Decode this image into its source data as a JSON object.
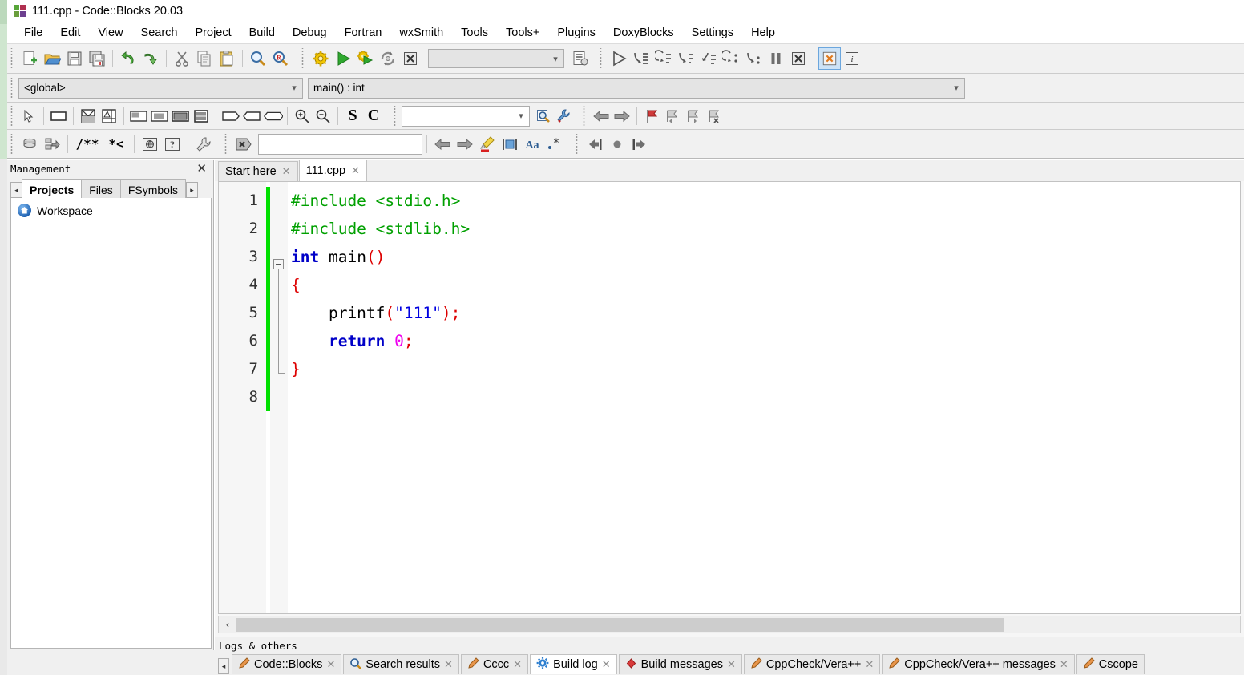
{
  "window": {
    "title": "111.cpp - Code::Blocks 20.03",
    "logo_name": "codeblocks-logo"
  },
  "menubar": {
    "items": [
      {
        "label": "File"
      },
      {
        "label": "Edit"
      },
      {
        "label": "View"
      },
      {
        "label": "Search"
      },
      {
        "label": "Project"
      },
      {
        "label": "Build"
      },
      {
        "label": "Debug"
      },
      {
        "label": "Fortran"
      },
      {
        "label": "wxSmith"
      },
      {
        "label": "Tools"
      },
      {
        "label": "Tools+"
      },
      {
        "label": "Plugins"
      },
      {
        "label": "DoxyBlocks"
      },
      {
        "label": "Settings"
      },
      {
        "label": "Help"
      }
    ]
  },
  "toolbars": {
    "main": {
      "buttons": [
        {
          "name": "new-file-icon",
          "title": "New file"
        },
        {
          "name": "open-file-icon",
          "title": "Open"
        },
        {
          "name": "save-icon",
          "title": "Save"
        },
        {
          "name": "save-all-icon",
          "title": "Save all"
        },
        {
          "name": "undo-icon",
          "title": "Undo"
        },
        {
          "name": "redo-icon",
          "title": "Redo"
        },
        {
          "name": "cut-icon",
          "title": "Cut"
        },
        {
          "name": "copy-icon",
          "title": "Copy"
        },
        {
          "name": "paste-icon",
          "title": "Paste"
        },
        {
          "name": "find-icon",
          "title": "Find"
        },
        {
          "name": "replace-icon",
          "title": "Replace"
        }
      ]
    },
    "build": {
      "buttons": [
        {
          "name": "build-icon",
          "title": "Build"
        },
        {
          "name": "run-icon",
          "title": "Run"
        },
        {
          "name": "build-and-run-icon",
          "title": "Build and run"
        },
        {
          "name": "rebuild-icon",
          "title": "Rebuild"
        },
        {
          "name": "abort-build-icon",
          "title": "Abort"
        }
      ],
      "target_value": "",
      "target_placeholder": "",
      "extra_button": {
        "name": "build-target-options-icon",
        "title": "Build targets"
      }
    },
    "debug": {
      "buttons": [
        {
          "name": "debug-continue-icon",
          "title": "Debug / Continue"
        },
        {
          "name": "run-to-cursor-icon",
          "title": "Run to cursor"
        },
        {
          "name": "next-line-icon",
          "title": "Next line"
        },
        {
          "name": "step-into-icon",
          "title": "Step into"
        },
        {
          "name": "step-out-icon",
          "title": "Step out"
        },
        {
          "name": "next-instruction-icon",
          "title": "Next instruction"
        },
        {
          "name": "step-into-instruction-icon",
          "title": "Step into instruction"
        },
        {
          "name": "break-debugger-icon",
          "title": "Break debugger"
        },
        {
          "name": "stop-debugger-icon",
          "title": "Stop debugger"
        },
        {
          "name": "debugging-windows-icon",
          "title": "Debugging windows"
        },
        {
          "name": "various-info-icon",
          "title": "Various info"
        }
      ]
    },
    "scope": {
      "global_value": "<global>",
      "function_value": "main() : int"
    },
    "wxsmith": {
      "buttons": [
        {
          "name": "pointer-icon",
          "title": "Select"
        },
        {
          "name": "panel-icon",
          "title": "Panel"
        },
        {
          "name": "split-vertical-icon",
          "title": "Split vertical"
        },
        {
          "name": "split-custom-icon",
          "title": "Custom split"
        },
        {
          "name": "layout-left-icon",
          "title": "Layout left"
        },
        {
          "name": "layout-center-icon",
          "title": "Layout center"
        },
        {
          "name": "layout-fill-icon",
          "title": "Layout fill"
        },
        {
          "name": "layout-stack-icon",
          "title": "Layout stack"
        },
        {
          "name": "expand-right-icon",
          "title": "Expand right"
        },
        {
          "name": "expand-left-icon",
          "title": "Expand left"
        },
        {
          "name": "expand-both-icon",
          "title": "Expand both"
        }
      ]
    },
    "zoom": {
      "buttons": [
        {
          "name": "zoom-in-icon",
          "title": "Zoom in"
        },
        {
          "name": "zoom-out-icon",
          "title": "Zoom out"
        }
      ],
      "labels": [
        "S",
        "C"
      ]
    },
    "incremental_search": {
      "value": "",
      "placeholder": "",
      "buttons": [
        {
          "name": "search-preview-icon",
          "title": "Search"
        },
        {
          "name": "search-options-icon",
          "title": "Options"
        }
      ]
    },
    "navigation": {
      "buttons": [
        {
          "name": "back-icon",
          "title": "Back"
        },
        {
          "name": "forward-icon",
          "title": "Forward"
        },
        {
          "name": "toggle-bookmark-icon",
          "title": "Toggle bookmark"
        },
        {
          "name": "previous-bookmark-icon",
          "title": "Previous bookmark"
        },
        {
          "name": "next-bookmark-icon",
          "title": "Next bookmark"
        },
        {
          "name": "clear-bookmarks-icon",
          "title": "Clear bookmarks"
        }
      ]
    },
    "doxyblocks": {
      "buttons": [
        {
          "name": "doxyblocks-run-icon",
          "title": "Run DoxyBlocks"
        },
        {
          "name": "doxyblocks-extract-icon",
          "title": "Extract documentation"
        }
      ],
      "labels": [
        "/**",
        "*<"
      ],
      "more_buttons": [
        {
          "name": "doxyblocks-html-icon",
          "title": "Open HTML docs"
        },
        {
          "name": "doxyblocks-chm-icon",
          "title": "Open CHM docs"
        },
        {
          "name": "doxyblocks-config-icon",
          "title": "Configure"
        }
      ]
    },
    "thread_search": {
      "run_button": {
        "name": "thread-search-icon",
        "title": "Thread search"
      },
      "value": "",
      "placeholder": "",
      "buttons": [
        {
          "name": "search-back-icon",
          "title": "Search backwards"
        },
        {
          "name": "search-forward-icon",
          "title": "Search forwards"
        },
        {
          "name": "highlight-icon",
          "title": "Highlight"
        },
        {
          "name": "whole-word-icon",
          "title": "Whole word"
        },
        {
          "name": "match-case-icon",
          "title": "Match case"
        },
        {
          "name": "regex-icon",
          "title": "Regular expression"
        }
      ]
    },
    "browse_tracker": {
      "buttons": [
        {
          "name": "browse-backward-icon",
          "title": "Backward ed position"
        },
        {
          "name": "browse-mark-icon",
          "title": "Mark position"
        },
        {
          "name": "browse-forward-icon",
          "title": "Forward ed position"
        }
      ]
    }
  },
  "management": {
    "title": "Management",
    "close_label": "✕",
    "scroll_left": "◂",
    "scroll_right": "▸",
    "tabs": [
      {
        "label": "Projects",
        "selected": true
      },
      {
        "label": "Files",
        "selected": false
      },
      {
        "label": "FSymbols",
        "selected": false
      }
    ],
    "tree": [
      {
        "label": "Workspace",
        "icon": "home-icon"
      }
    ]
  },
  "editor": {
    "tabs": [
      {
        "label": "Start here",
        "selected": false,
        "close": "✕"
      },
      {
        "label": "111.cpp",
        "selected": true,
        "close": "✕"
      }
    ],
    "line_numbers": [
      "1",
      "2",
      "3",
      "4",
      "5",
      "6",
      "7",
      "8"
    ],
    "code_lines": [
      {
        "n": 1,
        "tokens": [
          {
            "t": "#include <stdio.h>",
            "c": "t-pre"
          }
        ]
      },
      {
        "n": 2,
        "tokens": [
          {
            "t": "#include <stdlib.h>",
            "c": "t-pre"
          }
        ]
      },
      {
        "n": 3,
        "tokens": [
          {
            "t": "int",
            "c": "t-key"
          },
          {
            "t": " main",
            "c": "t-id"
          },
          {
            "t": "()",
            "c": "t-pun"
          }
        ]
      },
      {
        "n": 4,
        "tokens": [
          {
            "t": "{",
            "c": "t-pun"
          }
        ]
      },
      {
        "n": 5,
        "tokens": [
          {
            "t": "    printf",
            "c": "t-id"
          },
          {
            "t": "(",
            "c": "t-pun"
          },
          {
            "t": "\"111\"",
            "c": "t-str"
          },
          {
            "t": ");",
            "c": "t-pun"
          }
        ]
      },
      {
        "n": 6,
        "tokens": [
          {
            "t": "    return",
            "c": "t-key"
          },
          {
            "t": " 0",
            "c": "t-num"
          },
          {
            "t": ";",
            "c": "t-pun"
          }
        ]
      },
      {
        "n": 7,
        "tokens": [
          {
            "t": "}",
            "c": "t-pun"
          }
        ]
      },
      {
        "n": 8,
        "tokens": [
          {
            "t": "",
            "c": "t-id"
          }
        ]
      }
    ],
    "scrollbar": {
      "left_arrow": "‹"
    }
  },
  "logs": {
    "title": "Logs & others",
    "scroll_left": "◂",
    "tabs": [
      {
        "label": "Code::Blocks",
        "icon": "pencil-icon",
        "selected": false,
        "close": "✕"
      },
      {
        "label": "Search results",
        "icon": "magnifier-icon",
        "selected": false,
        "close": "✕"
      },
      {
        "label": "Cccc",
        "icon": "pencil-icon",
        "selected": false,
        "close": "✕"
      },
      {
        "label": "Build log",
        "icon": "gear-icon",
        "selected": true,
        "close": "✕"
      },
      {
        "label": "Build messages",
        "icon": "diamond-icon",
        "selected": false,
        "close": "✕"
      },
      {
        "label": "CppCheck/Vera++",
        "icon": "pencil-icon",
        "selected": false,
        "close": "✕"
      },
      {
        "label": "CppCheck/Vera++ messages",
        "icon": "pencil-icon",
        "selected": false,
        "close": "✕"
      },
      {
        "label": "Cscope",
        "icon": "pencil-icon",
        "selected": false,
        "close": "✕"
      }
    ]
  },
  "colors": {
    "preprocessor": "#00a000",
    "keyword": "#0000c8",
    "string": "#0000e0",
    "number": "#ee00ee",
    "punctuation": "#dd0000",
    "change_bar": "#00e000",
    "toolbar_bg": "#f1f1f1"
  }
}
